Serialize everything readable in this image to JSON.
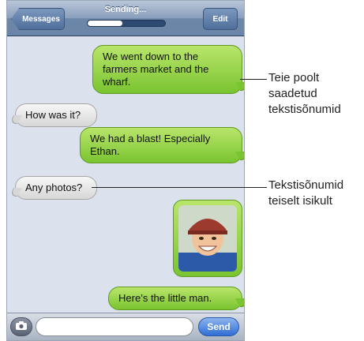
{
  "header": {
    "back_label": "Messages",
    "title": "Sending...",
    "edit_label": "Edit",
    "progress": 0.45
  },
  "messages": [
    {
      "from": "me",
      "text": "We went down to the farmers market and the wharf."
    },
    {
      "from": "them",
      "text": "How was it?"
    },
    {
      "from": "me",
      "text": "We had a blast! Especially Ethan."
    },
    {
      "from": "them",
      "text": "Any photos?"
    },
    {
      "from": "me",
      "type": "photo"
    },
    {
      "from": "me",
      "text": "Here’s the little man."
    }
  ],
  "toolbar": {
    "camera_icon": "camera-icon",
    "input_value": "",
    "send_label": "Send"
  },
  "callouts": {
    "sent": "Teie poolt saadetud tekstisõnumid",
    "received": "Tekstisõnumid teiselt isikult"
  }
}
